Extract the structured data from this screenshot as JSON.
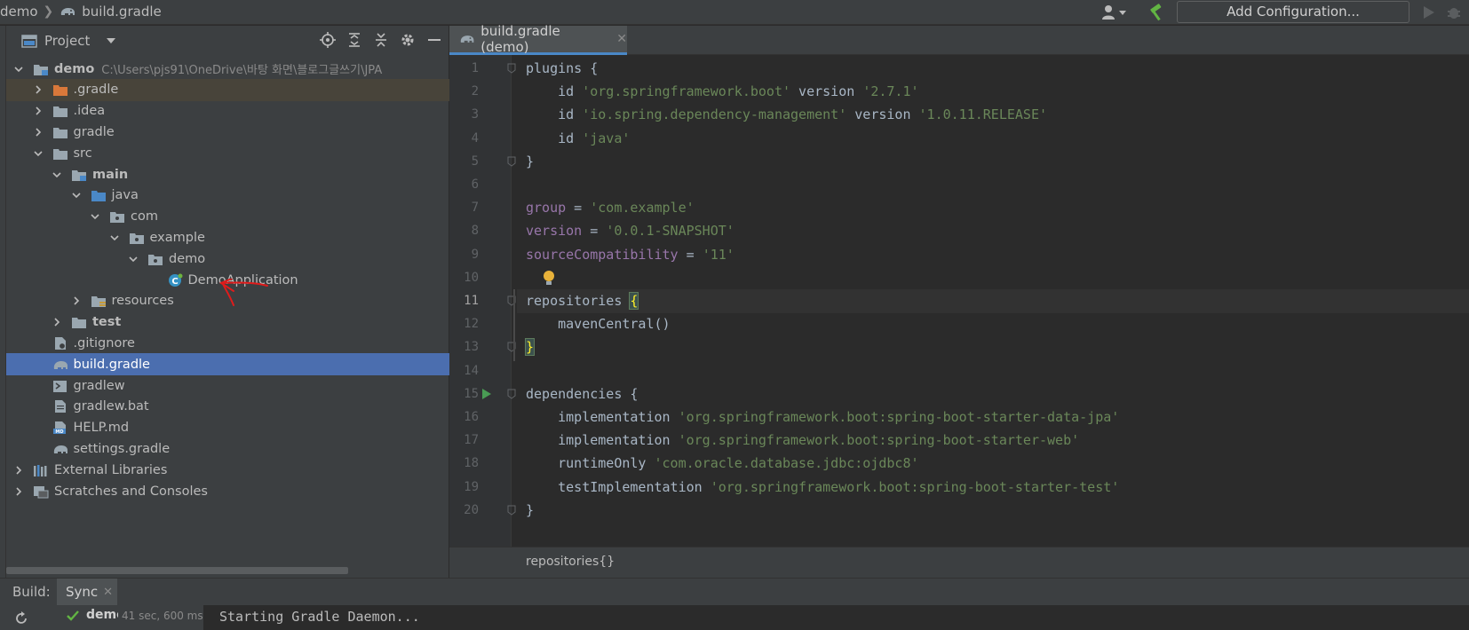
{
  "breadcrumb": {
    "project": "demo",
    "file": "build.gradle"
  },
  "toolbar": {
    "add_configuration": "Add Configuration..."
  },
  "project_panel": {
    "title": "Project",
    "tree": [
      {
        "label": "demo",
        "path": "C:\\Users\\pjs91\\OneDrive\\바탕 화면\\블로그글쓰기\\JPA",
        "depth": 0,
        "expanded": true,
        "bold": true,
        "icon": "module-folder-icon"
      },
      {
        "label": ".gradle",
        "depth": 1,
        "expanded": false,
        "icon": "orange-folder-icon",
        "highlight": "excluded"
      },
      {
        "label": ".idea",
        "depth": 1,
        "expanded": false,
        "icon": "folder-icon"
      },
      {
        "label": "gradle",
        "depth": 1,
        "expanded": false,
        "icon": "folder-icon"
      },
      {
        "label": "src",
        "depth": 1,
        "expanded": true,
        "icon": "folder-icon"
      },
      {
        "label": "main",
        "depth": 2,
        "expanded": true,
        "bold": true,
        "icon": "module-folder-icon"
      },
      {
        "label": "java",
        "depth": 3,
        "expanded": true,
        "icon": "source-folder-icon"
      },
      {
        "label": "com",
        "depth": 4,
        "expanded": true,
        "icon": "package-icon"
      },
      {
        "label": "example",
        "depth": 5,
        "expanded": true,
        "icon": "package-icon"
      },
      {
        "label": "demo",
        "depth": 6,
        "expanded": true,
        "icon": "package-icon"
      },
      {
        "label": "DemoApplication",
        "depth": 7,
        "icon": "spring-class-icon"
      },
      {
        "label": "resources",
        "depth": 3,
        "expanded": false,
        "icon": "resources-folder-icon"
      },
      {
        "label": "test",
        "depth": 2,
        "expanded": false,
        "bold": true,
        "icon": "folder-icon"
      },
      {
        "label": ".gitignore",
        "depth": 1,
        "icon": "gitignore-file-icon"
      },
      {
        "label": "build.gradle",
        "depth": 1,
        "icon": "gradle-elephant-icon",
        "selected": true
      },
      {
        "label": "gradlew",
        "depth": 1,
        "icon": "shell-script-icon"
      },
      {
        "label": "gradlew.bat",
        "depth": 1,
        "icon": "text-file-icon"
      },
      {
        "label": "HELP.md",
        "depth": 1,
        "icon": "markdown-file-icon"
      },
      {
        "label": "settings.gradle",
        "depth": 1,
        "icon": "gradle-elephant-icon"
      },
      {
        "label": "External Libraries",
        "depth": 0,
        "expanded": false,
        "icon": "libraries-icon"
      },
      {
        "label": "Scratches and Consoles",
        "depth": 0,
        "expanded": false,
        "icon": "scratches-icon"
      }
    ]
  },
  "editor": {
    "tab_label": "build.gradle (demo)",
    "current_line": 11,
    "lines": [
      {
        "n": "1",
        "tokens": [
          [
            "plain",
            "plugins {"
          ]
        ]
      },
      {
        "n": "2",
        "tokens": [
          [
            "plain",
            "    id "
          ],
          [
            "str",
            "'org.springframework.boot'"
          ],
          [
            "plain",
            " version "
          ],
          [
            "str",
            "'2.7.1'"
          ]
        ]
      },
      {
        "n": "3",
        "tokens": [
          [
            "plain",
            "    id "
          ],
          [
            "str",
            "'io.spring.dependency-management'"
          ],
          [
            "plain",
            " version "
          ],
          [
            "str",
            "'1.0.11.RELEASE'"
          ]
        ]
      },
      {
        "n": "4",
        "tokens": [
          [
            "plain",
            "    id "
          ],
          [
            "str",
            "'java'"
          ]
        ]
      },
      {
        "n": "5",
        "tokens": [
          [
            "plain",
            "}"
          ]
        ]
      },
      {
        "n": "6",
        "tokens": []
      },
      {
        "n": "7",
        "tokens": [
          [
            "prop",
            "group"
          ],
          [
            "plain",
            " = "
          ],
          [
            "str",
            "'com.example'"
          ]
        ]
      },
      {
        "n": "8",
        "tokens": [
          [
            "prop",
            "version"
          ],
          [
            "plain",
            " = "
          ],
          [
            "str",
            "'0.0.1-SNAPSHOT'"
          ]
        ]
      },
      {
        "n": "9",
        "tokens": [
          [
            "prop",
            "sourceCompatibility"
          ],
          [
            "plain",
            " = "
          ],
          [
            "str",
            "'11'"
          ]
        ]
      },
      {
        "n": "10",
        "tokens": []
      },
      {
        "n": "11",
        "tokens": [
          [
            "plain",
            "repositories "
          ],
          [
            "brace",
            "{"
          ]
        ]
      },
      {
        "n": "12",
        "tokens": [
          [
            "plain",
            "    mavenCentral()"
          ]
        ]
      },
      {
        "n": "13",
        "tokens": [
          [
            "brace",
            "}"
          ]
        ]
      },
      {
        "n": "14",
        "tokens": []
      },
      {
        "n": "15",
        "tokens": [
          [
            "plain",
            "dependencies {"
          ]
        ]
      },
      {
        "n": "16",
        "tokens": [
          [
            "plain",
            "    implementation "
          ],
          [
            "str",
            "'org.springframework.boot:spring-boot-starter-data-jpa'"
          ]
        ]
      },
      {
        "n": "17",
        "tokens": [
          [
            "plain",
            "    implementation "
          ],
          [
            "str",
            "'org.springframework.boot:spring-boot-starter-web'"
          ]
        ]
      },
      {
        "n": "18",
        "tokens": [
          [
            "plain",
            "    runtimeOnly "
          ],
          [
            "str",
            "'com.oracle.database.jdbc:ojdbc8'"
          ]
        ]
      },
      {
        "n": "19",
        "tokens": [
          [
            "plain",
            "    testImplementation "
          ],
          [
            "str",
            "'org.springframework.boot:spring-boot-starter-test'"
          ]
        ]
      },
      {
        "n": "20",
        "tokens": [
          [
            "plain",
            "}"
          ]
        ]
      }
    ],
    "breadcrumb_status": "repositories{}"
  },
  "build_panel": {
    "label": "Build:",
    "tab": "Sync",
    "task": "demo",
    "duration": "41 sec, 600 ms",
    "output": "Starting Gradle Daemon..."
  },
  "colors": {
    "selection": "#4b6eaf",
    "string": "#6a8759",
    "property": "#9876aa",
    "brace_highlight": "#ffef28",
    "annotation_arrow": "#e01b1b"
  }
}
